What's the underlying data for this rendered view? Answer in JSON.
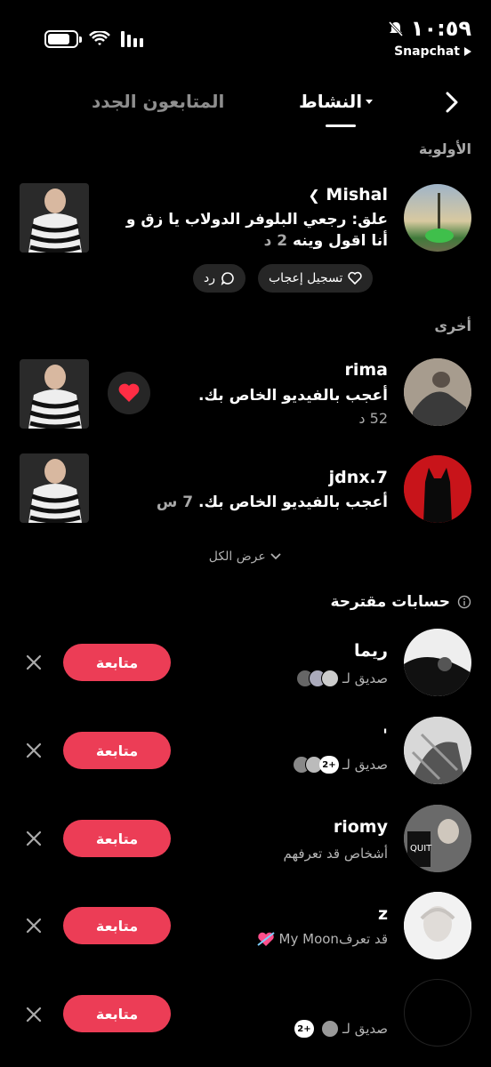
{
  "status_bar": {
    "time": "١٠:٥٩",
    "back_app": "Snapchat"
  },
  "header": {
    "tab_activity": "النشاط",
    "tab_followers": "المتابعون الجدد"
  },
  "sections": {
    "priority": "الأولوية",
    "other": "أخرى",
    "suggested": "حسابات مقترحة"
  },
  "priority_item": {
    "username": "Mishal",
    "message": "علق: رجعي البلوفر الدولاب يا زق و أنا اقول وينه",
    "time": "2 د",
    "like_label": "تسجيل إعجاب",
    "reply_label": "رد"
  },
  "other_items": [
    {
      "username": "rima",
      "message": "أعجب بالفيديو الخاص بك.",
      "time": "52 د"
    },
    {
      "username": "jdnx.7",
      "message": "أعجب بالفيديو الخاص بك.",
      "time": "7 س"
    }
  ],
  "show_all": "عرض الكل",
  "suggested": [
    {
      "name": "ريما",
      "sub": "صديق لـ",
      "plus": ""
    },
    {
      "name": "'",
      "sub": "صديق لـ",
      "plus": "2+"
    },
    {
      "name": "riomy",
      "sub": "أشخاص قد تعرفهم",
      "plus": ""
    },
    {
      "name": "z",
      "sub": "قد تعرفMy Moon",
      "plus": ""
    },
    {
      "name": "",
      "sub": "صديق لـ",
      "plus": "2+"
    }
  ],
  "follow_label": "متابعة",
  "colors": {
    "background": "#000000",
    "accent": "#ec3d56",
    "pill": "#262626",
    "muted": "#a8a8a8"
  }
}
